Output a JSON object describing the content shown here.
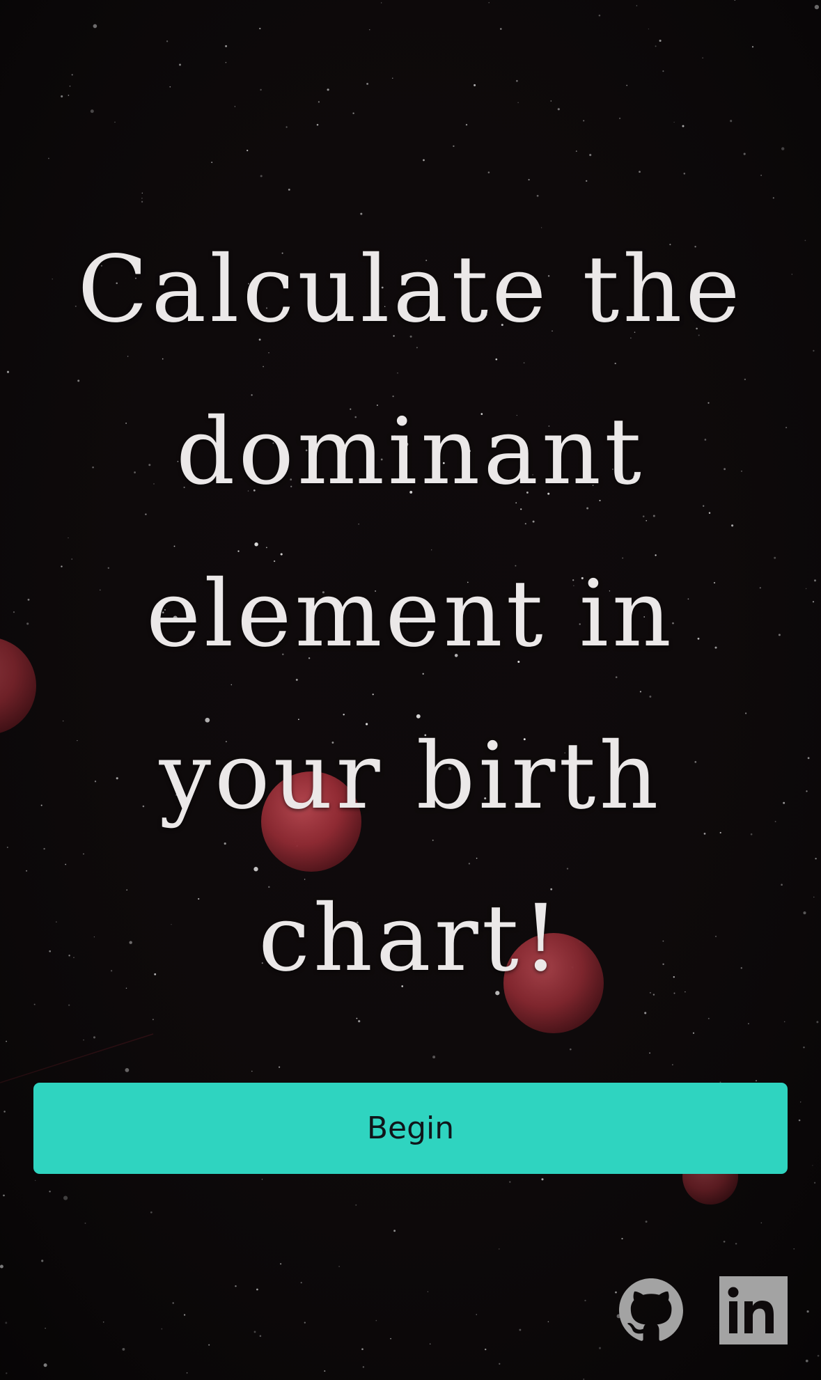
{
  "hero": {
    "headline_lines": [
      "Calculate the",
      "dominant",
      "element in",
      "your birth",
      "chart!"
    ]
  },
  "actions": {
    "begin_label": "Begin"
  },
  "social": {
    "github_icon": "github-icon",
    "linkedin_icon": "linkedin-icon"
  },
  "colors": {
    "accent": "#2fd4c0",
    "headline": "#ebe8e8",
    "background": "#0b0809",
    "moon": "#b8343e",
    "icon": "#a3a3a3"
  }
}
